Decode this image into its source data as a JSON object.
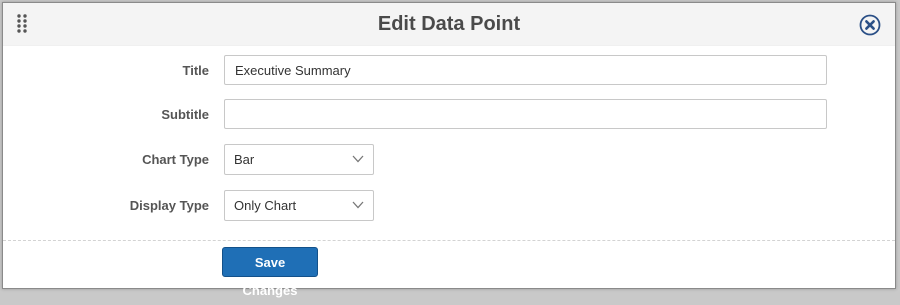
{
  "dialog": {
    "title": "Edit Data Point",
    "drag_icon": "drag-handle-icon",
    "close_icon": "close-circle-icon"
  },
  "form": {
    "title": {
      "label": "Title",
      "value": "Executive Summary",
      "placeholder": ""
    },
    "subtitle": {
      "label": "Subtitle",
      "value": "",
      "placeholder": ""
    },
    "chart_type": {
      "label": "Chart Type",
      "selected": "Bar"
    },
    "display_type": {
      "label": "Display Type",
      "selected": "Only Chart"
    }
  },
  "actions": {
    "save_label": "Save Changes"
  },
  "colors": {
    "accent": "#1f6fb6",
    "close_icon": "#2a4f86",
    "header_bg": "#f4f4f4",
    "label_text": "#555555"
  }
}
